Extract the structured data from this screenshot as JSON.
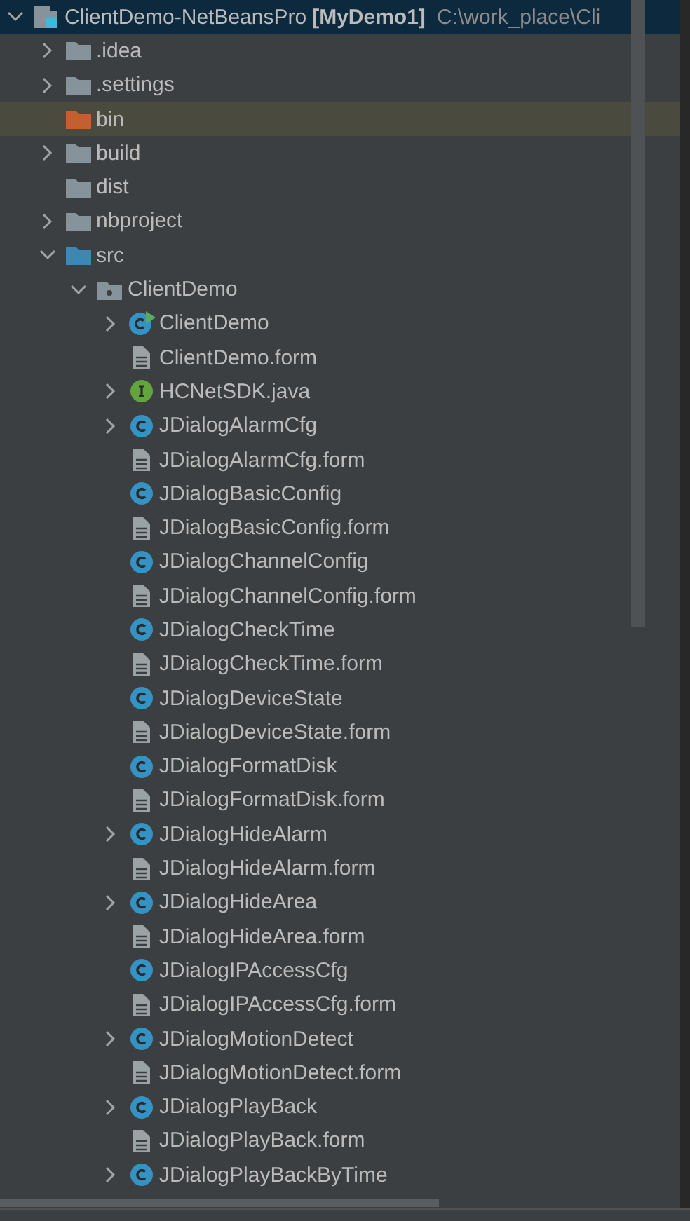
{
  "project": {
    "name": "ClientDemo-NetBeansPro",
    "module": "[MyDemo1]",
    "path": "C:\\work_place\\Cli",
    "expanded": true,
    "children": [
      {
        "label": ".idea",
        "kind": "folder",
        "expanded": false
      },
      {
        "label": ".settings",
        "kind": "folder",
        "expanded": false
      },
      {
        "label": "bin",
        "kind": "excluded-folder"
      },
      {
        "label": "build",
        "kind": "folder",
        "expanded": false
      },
      {
        "label": "dist",
        "kind": "folder"
      },
      {
        "label": "nbproject",
        "kind": "folder",
        "expanded": false
      },
      {
        "label": "src",
        "kind": "source-folder",
        "expanded": true,
        "children": [
          {
            "label": "ClientDemo",
            "kind": "package",
            "expanded": true,
            "children": [
              {
                "label": "ClientDemo",
                "kind": "main-class",
                "expanded": false
              },
              {
                "label": "ClientDemo.form",
                "kind": "form"
              },
              {
                "label": "HCNetSDK.java",
                "kind": "interface",
                "expanded": false
              },
              {
                "label": "JDialogAlarmCfg",
                "kind": "class",
                "expanded": false
              },
              {
                "label": "JDialogAlarmCfg.form",
                "kind": "form"
              },
              {
                "label": "JDialogBasicConfig",
                "kind": "class"
              },
              {
                "label": "JDialogBasicConfig.form",
                "kind": "form"
              },
              {
                "label": "JDialogChannelConfig",
                "kind": "class"
              },
              {
                "label": "JDialogChannelConfig.form",
                "kind": "form"
              },
              {
                "label": "JDialogCheckTime",
                "kind": "class"
              },
              {
                "label": "JDialogCheckTime.form",
                "kind": "form"
              },
              {
                "label": "JDialogDeviceState",
                "kind": "class"
              },
              {
                "label": "JDialogDeviceState.form",
                "kind": "form"
              },
              {
                "label": "JDialogFormatDisk",
                "kind": "class"
              },
              {
                "label": "JDialogFormatDisk.form",
                "kind": "form"
              },
              {
                "label": "JDialogHideAlarm",
                "kind": "class",
                "expanded": false
              },
              {
                "label": "JDialogHideAlarm.form",
                "kind": "form"
              },
              {
                "label": "JDialogHideArea",
                "kind": "class",
                "expanded": false
              },
              {
                "label": "JDialogHideArea.form",
                "kind": "form"
              },
              {
                "label": "JDialogIPAccessCfg",
                "kind": "class"
              },
              {
                "label": "JDialogIPAccessCfg.form",
                "kind": "form"
              },
              {
                "label": "JDialogMotionDetect",
                "kind": "class",
                "expanded": false
              },
              {
                "label": "JDialogMotionDetect.form",
                "kind": "form"
              },
              {
                "label": "JDialogPlayBack",
                "kind": "class",
                "expanded": false
              },
              {
                "label": "JDialogPlayBack.form",
                "kind": "form"
              },
              {
                "label": "JDialogPlayBackByTime",
                "kind": "class",
                "expanded": false
              }
            ]
          }
        ]
      }
    ]
  }
}
